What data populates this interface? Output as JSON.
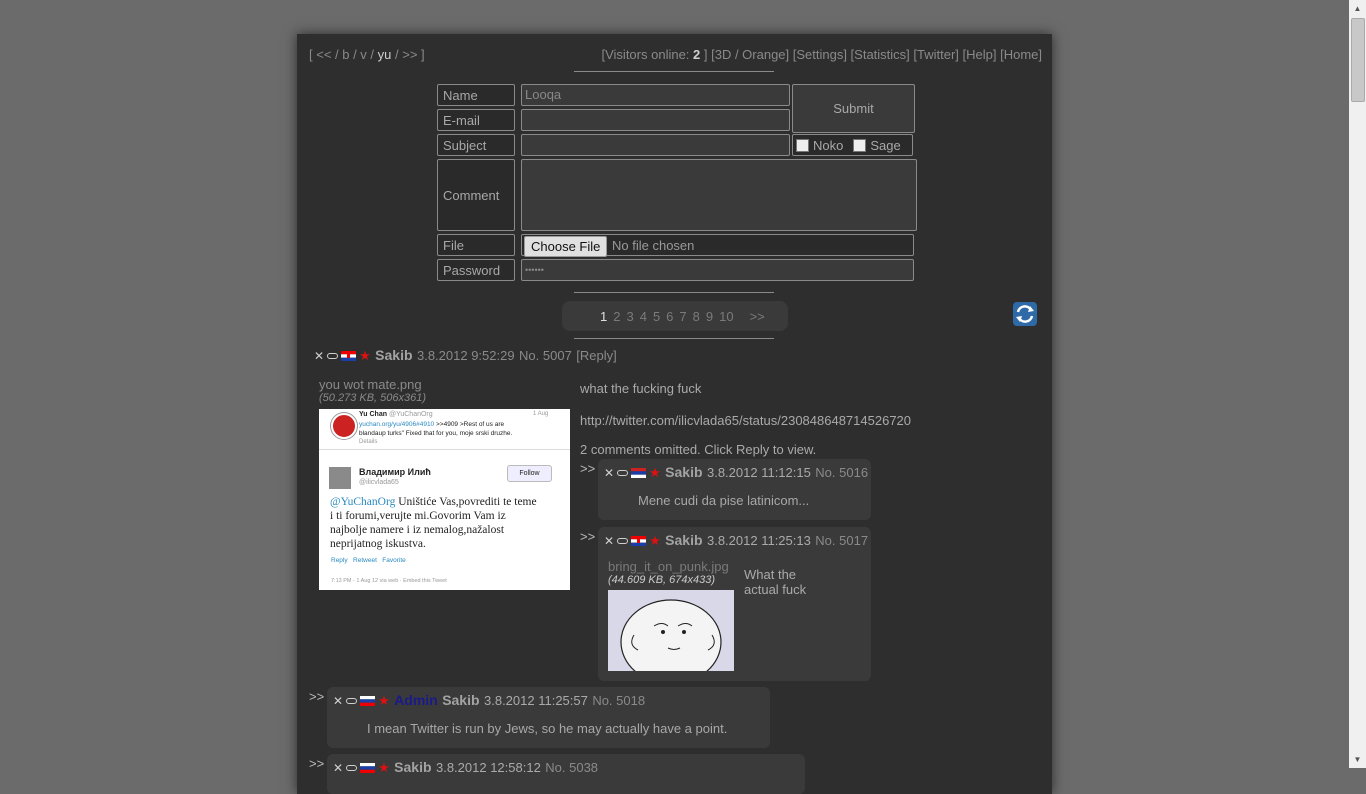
{
  "nav": {
    "board_links": "[ << / b / v / ",
    "current_board": "yu",
    "board_links_end": " / >> ]",
    "visitors_prefix": "[Visitors online: ",
    "visitors_count": "2",
    "right_links": " ] [3D / Orange] [Settings] [Statistics] [Twitter] [Help] [Home]"
  },
  "form": {
    "name_label": "Name",
    "name_value": "Looqa",
    "email_label": "E-mail",
    "subject_label": "Subject",
    "comment_label": "Comment",
    "file_label": "File",
    "password_label": "Password",
    "password_value": "••••••",
    "submit_label": "Submit",
    "noko_label": "Noko",
    "sage_label": "Sage",
    "choose_file_label": "Choose File",
    "no_file_label": "No file chosen"
  },
  "pager": {
    "pages": [
      "2",
      "3",
      "4",
      "5",
      "6",
      "7",
      "8",
      "9",
      "10"
    ],
    "current": "1",
    "next": ">>"
  },
  "op": {
    "name": "Sakib",
    "date": "3.8.2012 9:52:29",
    "number": "No. 5007",
    "reply_link": "[Reply]",
    "file_name": "you wot mate.png",
    "file_meta": "(50.273 KB, 506x361)",
    "text_line1": "what the fucking fuck",
    "text_line2": "http://twitter.com/ilicvlada65/status/230848648714526720",
    "omitted": "2 comments omitted. Click Reply to view.",
    "thumb": {
      "header_name": "Yu Chan",
      "header_handle": "@YuChanOrg",
      "header_date": "1 Aug",
      "header_line1": "yuchan.org/yu/4906#4910",
      "header_line2": " >>4909 >Rest of us are",
      "header_line3": "blandaup turks\" Fixed that for you, moje srski druzhe.",
      "details": "Details",
      "author_name": "Владимир Илић",
      "author_handle": "@ilicvlada65",
      "follow": "Follow",
      "mention": "@YuChanOrg",
      "tweet_text_1": " Uništiće Vas,povrediti te teme",
      "tweet_text_2": "i ti forumi,verujte mi.Govorim Vam iz",
      "tweet_text_3": "najbolje namere i iz nemalog,nažalost",
      "tweet_text_4": "neprijatnog iskustva.",
      "actions": "Reply   Retweet   Favorite",
      "footer": "7:13 PM - 1 Aug 12 via web · Embed this Tweet"
    }
  },
  "replies": [
    {
      "arrow": ">>",
      "name": "Sakib",
      "date": "3.8.2012 11:12:15",
      "number": "No. 5016",
      "text": "Mene cudi da pise latinicom..."
    },
    {
      "arrow": ">>",
      "name": "Sakib",
      "date": "3.8.2012 11:25:13",
      "number": "No. 5017",
      "file_name": "bring_it_on_punk.jpg",
      "file_meta": "(44.609 KB, 674x433)",
      "text_line1": "What the",
      "text_line2": "actual fuck"
    },
    {
      "arrow": ">>",
      "admin": "Admin",
      "name": "Sakib",
      "date": "3.8.2012 11:25:57",
      "number": "No. 5018",
      "text": "I mean Twitter is run by Jews, so he may actually have a point."
    },
    {
      "arrow": ">>",
      "name": "Sakib",
      "date": "3.8.2012 12:58:12",
      "number": "No. 5038"
    }
  ],
  "colors": {
    "background": "#6b6b6b",
    "panel": "#2e2e2e",
    "reply_bg": "#3a3a3a",
    "star": "#dd1111",
    "admin": "#1a1a8a"
  }
}
